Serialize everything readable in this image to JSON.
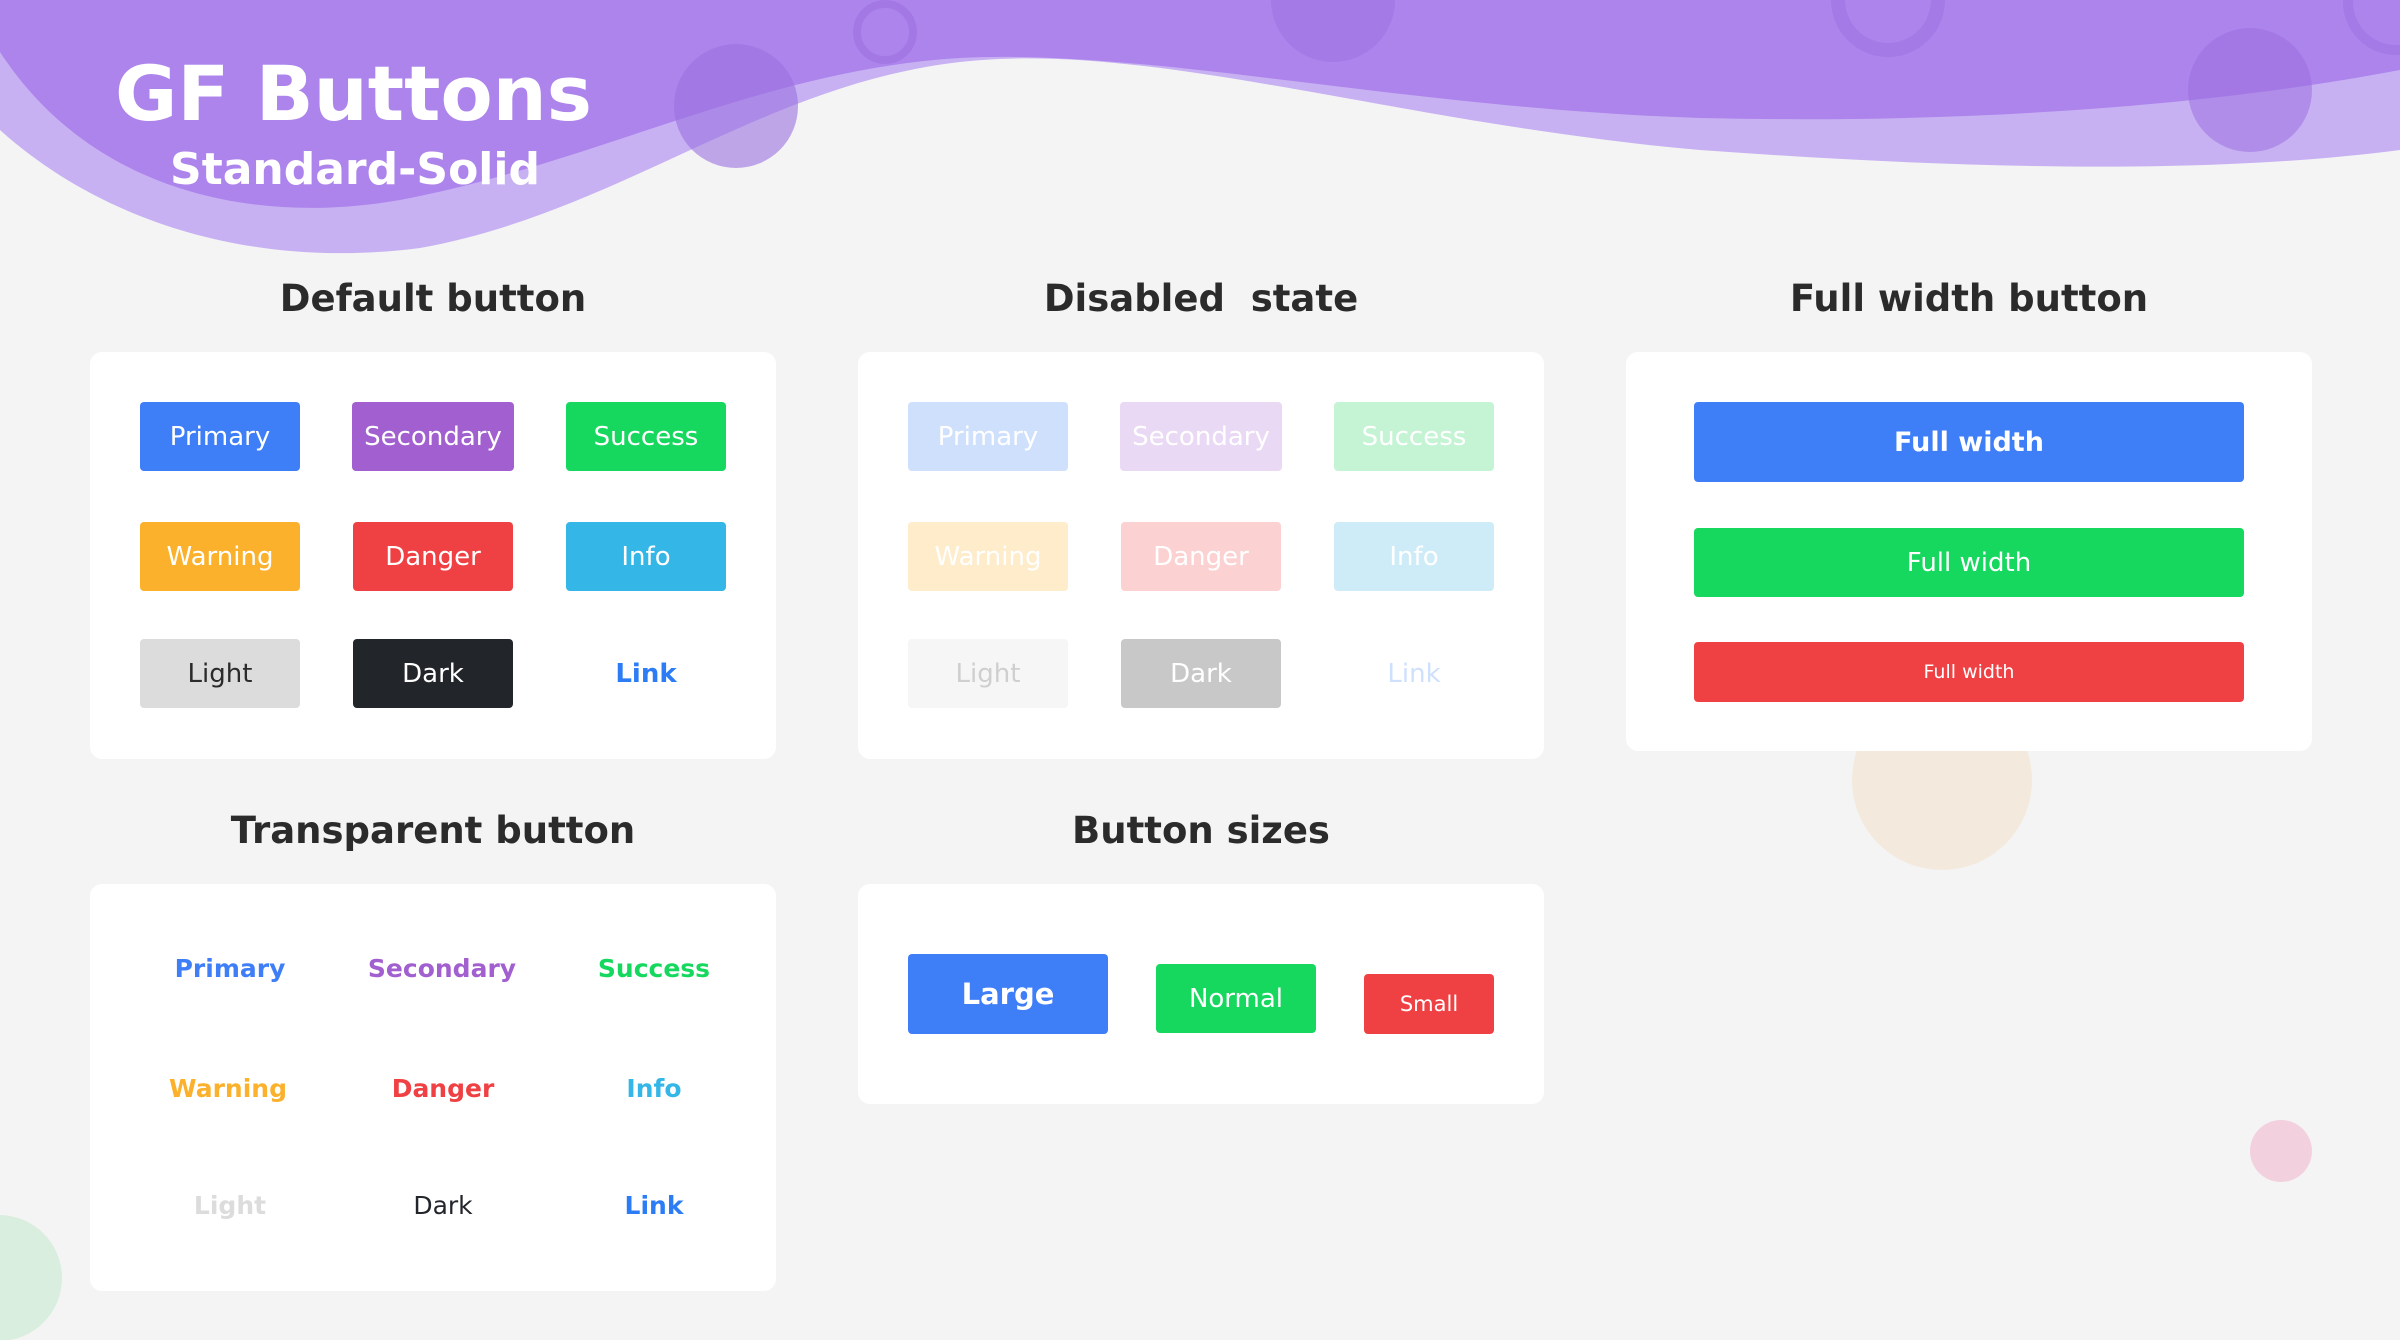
{
  "header": {
    "title": "GF Buttons",
    "subtitle": "Standard-Solid"
  },
  "colors": {
    "primary": "#3e7ef7",
    "secondary": "#a25fcf",
    "success": "#16d85f",
    "warning": "#fbb12c",
    "danger": "#ef4143",
    "info": "#34b6e7",
    "light": "#dcdcdc",
    "dark": "#22252a",
    "link": "#2b7cf5",
    "header_purple": "#ad84ec"
  },
  "default_section": {
    "heading": "Default button",
    "buttons": [
      "Primary",
      "Secondary",
      "Success",
      "Warning",
      "Danger",
      "Info",
      "Light",
      "Dark",
      "Link"
    ]
  },
  "disabled_section": {
    "heading": "Disabled  state",
    "buttons": [
      "Primary",
      "Secondary",
      "Success",
      "Warning",
      "Danger",
      "Info",
      "Light",
      "Dark",
      "Link"
    ]
  },
  "fullwidth_section": {
    "heading": "Full width button",
    "buttons": [
      "Full width",
      "Full width",
      "Full width"
    ]
  },
  "transparent_section": {
    "heading": "Transparent button",
    "buttons": [
      "Primary",
      "Secondary",
      "Success",
      "Warning",
      "Danger",
      "Info",
      "Light",
      "Dark",
      "Link"
    ]
  },
  "sizes_section": {
    "heading": "Button sizes",
    "buttons": [
      "Large",
      "Normal",
      "Small"
    ]
  }
}
